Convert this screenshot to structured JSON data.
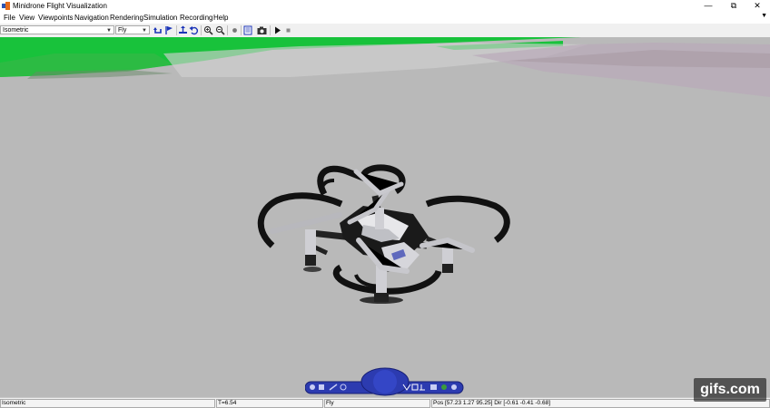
{
  "window": {
    "title": "Minidrone Flight Visualization"
  },
  "menu": {
    "items": [
      "File",
      "View",
      "Viewpoints",
      "Navigation",
      "Rendering",
      "Simulation",
      "Recording",
      "Help"
    ]
  },
  "toolbar": {
    "viewpoint_value": "Isometric",
    "mode_value": "Fly"
  },
  "status": {
    "viewpoint": "Isometric",
    "time": "T=6.54",
    "mode": "Fly",
    "pos_dir": "Pos [57.23 1.27 95.25]  Dir [-0.61 -0.41 -0.68]"
  },
  "watermark": {
    "text": "gifs.com"
  },
  "colors": {
    "ground": "#b9b9b9",
    "grass": "#18c23b",
    "navpanel": "#2c3bb0"
  },
  "icons": [
    "app-icon",
    "minimize-icon",
    "restore-icon",
    "close-icon",
    "dropdown-arrow-icon",
    "play-icon",
    "stop-icon",
    "record-icon",
    "snapshot-icon",
    "zoom-in-icon",
    "zoom-out-icon",
    "undo-icon",
    "help-icon"
  ]
}
